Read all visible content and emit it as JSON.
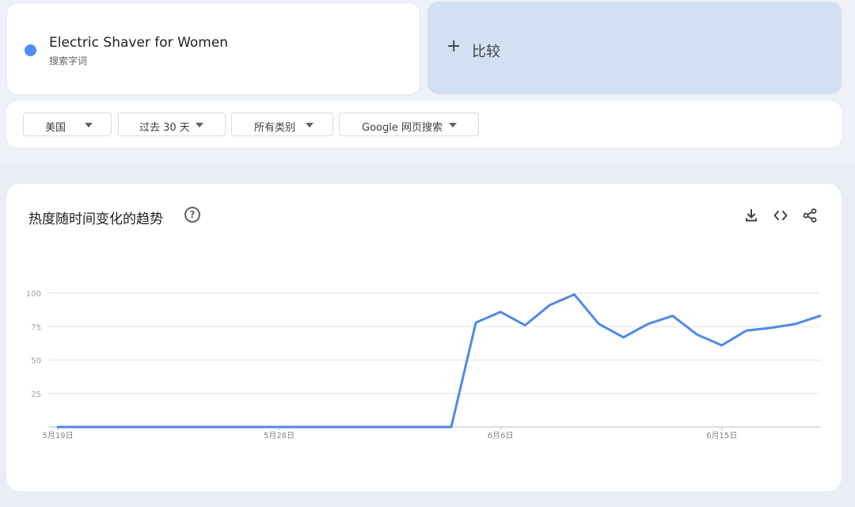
{
  "search_term": {
    "title": "Electric Shaver for Women",
    "subtitle": "搜索字词",
    "dot_color": "#4d8ef3"
  },
  "compare": {
    "plus_icon": "plus-icon",
    "label": "比较"
  },
  "filters": [
    {
      "label": "美国"
    },
    {
      "label": "过去 30 天"
    },
    {
      "label": "所有类别"
    },
    {
      "label": "Google 网页搜索"
    }
  ],
  "chart_panel": {
    "title": "热度随时间变化的趋势",
    "icons": [
      "help-icon",
      "download-icon",
      "embed-code-icon",
      "share-icon"
    ]
  },
  "chart_data": {
    "type": "line",
    "x": [
      "5月19日",
      "5月20日",
      "5月21日",
      "5月22日",
      "5月23日",
      "5月24日",
      "5月25日",
      "5月26日",
      "5月27日",
      "5月28日",
      "5月29日",
      "5月30日",
      "5月31日",
      "6月1日",
      "6月2日",
      "6月3日",
      "6月4日",
      "6月5日",
      "6月6日",
      "6月7日",
      "6月8日",
      "6月9日",
      "6月10日",
      "6月11日",
      "6月12日",
      "6月13日",
      "6月14日",
      "6月15日",
      "6月16日",
      "6月17日",
      "6月18日",
      "6月19日"
    ],
    "series": [
      {
        "color": "#4e8ae8",
        "values": [
          0,
          0,
          0,
          0,
          0,
          0,
          0,
          0,
          0,
          0,
          0,
          0,
          0,
          0,
          0,
          0,
          0,
          78,
          86,
          76,
          91,
          99,
          77,
          67,
          77,
          83,
          69,
          61,
          72,
          74,
          77,
          83
        ]
      }
    ],
    "x_tick_labels": [
      "5月19日",
      "5月28日",
      "6月6日",
      "6月15日"
    ],
    "y_ticks": [
      25,
      50,
      75,
      100
    ],
    "ylim": [
      0,
      100
    ],
    "grid": true,
    "legend": "none"
  }
}
